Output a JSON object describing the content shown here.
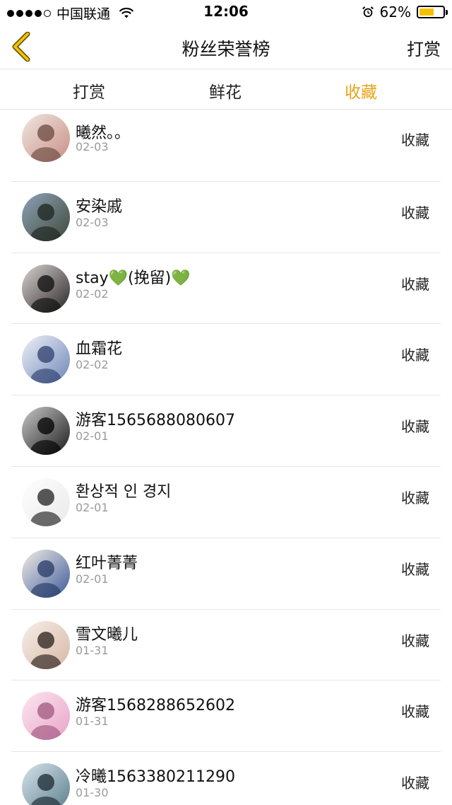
{
  "status_bar": {
    "carrier": "中国联通",
    "time": "12:06",
    "battery": "62%",
    "battery_level": 0.62,
    "signal_bars": 4,
    "icons": [
      "wifi-icon",
      "alarm-icon",
      "battery-icon"
    ]
  },
  "nav": {
    "back_icon": "chevron-left-icon",
    "title": "粉丝荣誉榜",
    "right_label": "打赏"
  },
  "tabs": [
    {
      "label": "打赏",
      "active": false
    },
    {
      "label": "鲜花",
      "active": false
    },
    {
      "label": "收藏",
      "active": true
    }
  ],
  "colors": {
    "accent": "#e8a317",
    "divider": "#e6e6e6",
    "date_text": "#9a9a9a"
  },
  "list": [
    {
      "name": "曦然。。",
      "date": "02-03",
      "action": "收藏",
      "avatar": {
        "bg1": "#f0e6e0",
        "bg2": "#c98f86",
        "fg": "#6b4a3f"
      }
    },
    {
      "name": "安染戚",
      "date": "02-03",
      "action": "收藏",
      "avatar": {
        "bg1": "#8ea2b8",
        "bg2": "#3e4a3a",
        "fg": "#1f2420"
      }
    },
    {
      "name": "stay💚(挽留)💚",
      "date": "02-02",
      "action": "收藏",
      "avatar": {
        "bg1": "#d9d4d2",
        "bg2": "#2b2626",
        "fg": "#0e0c0c"
      }
    },
    {
      "name": "血霜花",
      "date": "02-02",
      "action": "收藏",
      "avatar": {
        "bg1": "#eef1f7",
        "bg2": "#6f86b8",
        "fg": "#2d3f6e"
      }
    },
    {
      "name": "游客1565688080607",
      "date": "02-01",
      "action": "收藏",
      "avatar": {
        "bg1": "#c8c8c8",
        "bg2": "#1c1c1c",
        "fg": "#000000"
      }
    },
    {
      "name": "환상적 인 경지",
      "date": "02-01",
      "action": "收藏",
      "avatar": {
        "bg1": "#ffffff",
        "bg2": "#e9e9e9",
        "fg": "#202020"
      }
    },
    {
      "name": "红叶菁菁",
      "date": "02-01",
      "action": "收藏",
      "avatar": {
        "bg1": "#f2ede6",
        "bg2": "#3f5b9b",
        "fg": "#273a66"
      }
    },
    {
      "name": "雪文曦儿",
      "date": "01-31",
      "action": "收藏",
      "avatar": {
        "bg1": "#f7efe9",
        "bg2": "#d8b7a5",
        "fg": "#2a1f1b"
      }
    },
    {
      "name": "游客1568288652602",
      "date": "01-31",
      "action": "收藏",
      "avatar": {
        "bg1": "#fbe7f0",
        "bg2": "#e9a3c7",
        "fg": "#a0587f"
      }
    },
    {
      "name": "冷曦1563380211290",
      "date": "01-30",
      "action": "收藏",
      "avatar": {
        "bg1": "#d7e4ea",
        "bg2": "#5b7e8e",
        "fg": "#1b2a33"
      }
    }
  ]
}
